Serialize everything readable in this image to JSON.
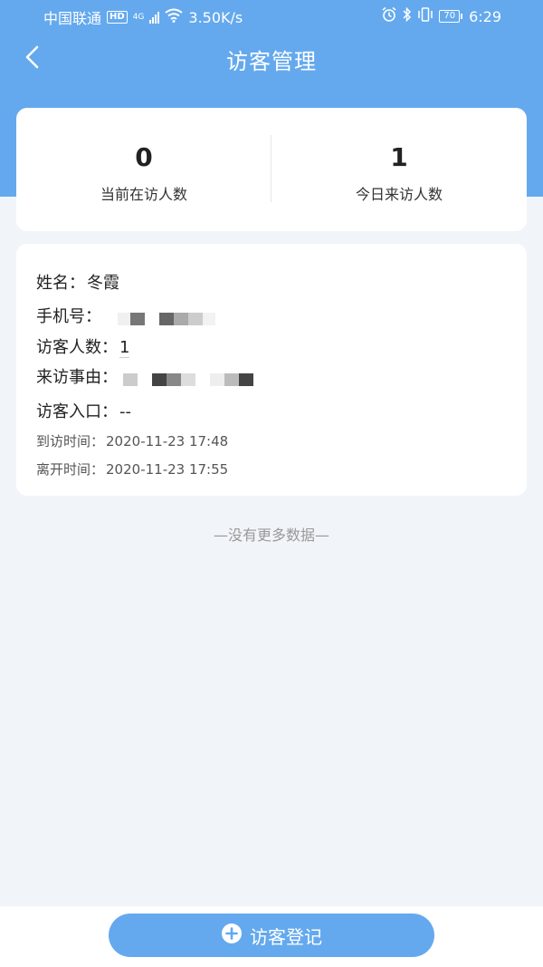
{
  "status_bar": {
    "carrier": "中国联通",
    "hd": "HD",
    "network": "4G",
    "speed": "3.50K/s",
    "battery": "70",
    "time": "6:29"
  },
  "nav": {
    "back_icon": "chevron-left-icon",
    "title": "访客管理"
  },
  "stats": [
    {
      "value": "0",
      "label": "当前在访人数"
    },
    {
      "value": "1",
      "label": "今日来访人数"
    }
  ],
  "visitor": {
    "name_label": "姓名：",
    "name": "冬霞",
    "phone_label": "手机号：",
    "count_label": "访客人数：",
    "count": "1",
    "reason_label": "来访事由：",
    "entrance_label": "访客入口：",
    "entrance": "--",
    "arrive_label": "到访时间：",
    "arrive_time": "2020-11-23 17:48",
    "leave_label": "离开时间：",
    "leave_time": "2020-11-23 17:55"
  },
  "list_end_text": "—没有更多数据—",
  "register_button": {
    "icon": "plus-circle-icon",
    "label": "访客登记"
  },
  "colors": {
    "accent": "#64a9ee",
    "background": "#f1f4f8"
  }
}
